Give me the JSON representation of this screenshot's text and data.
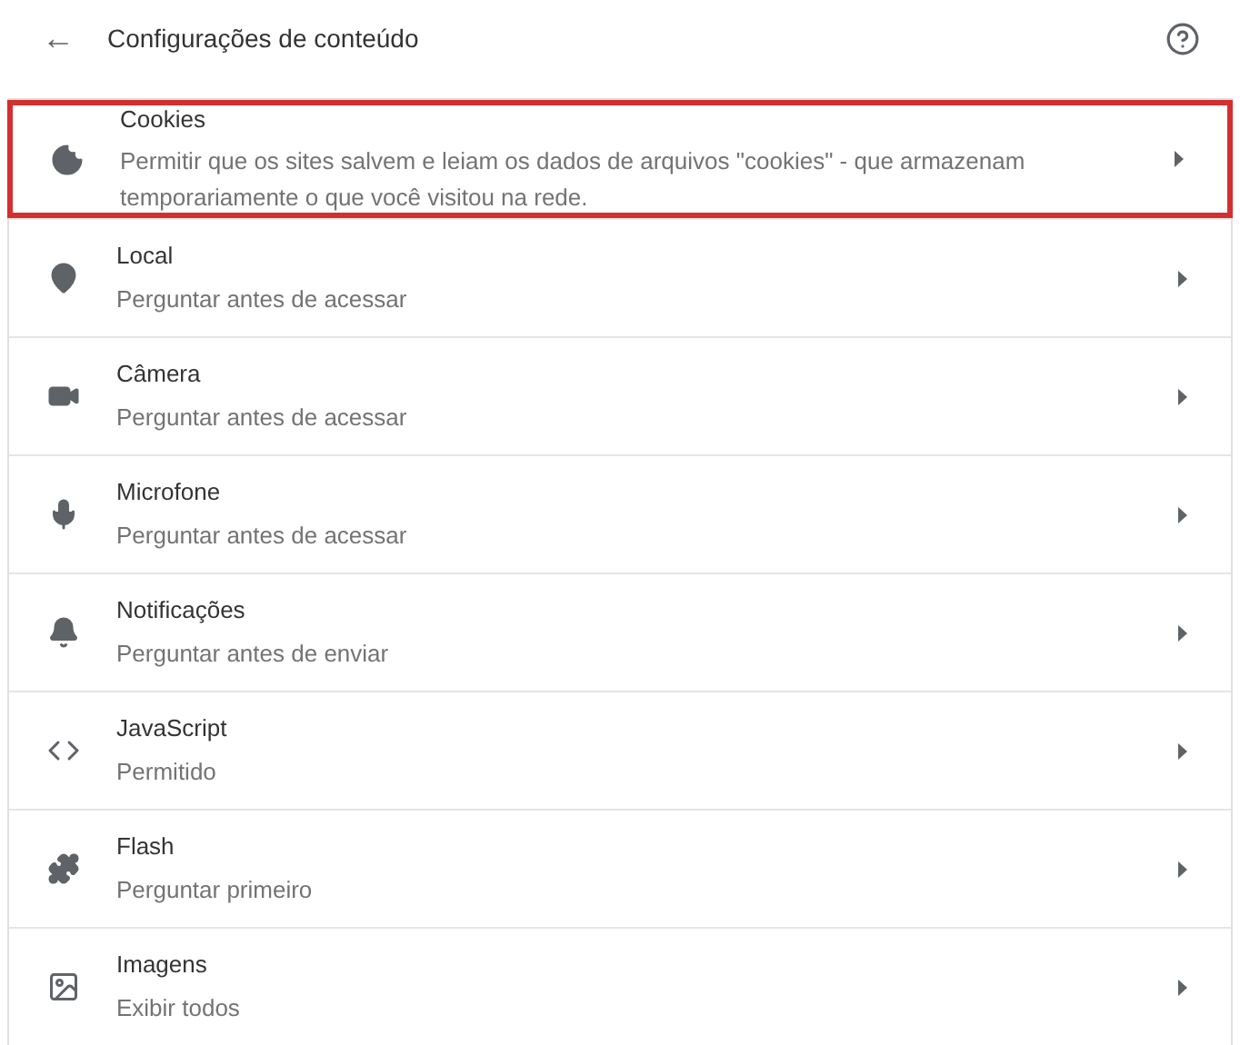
{
  "header": {
    "back": "←",
    "title": "Configurações de conteúdo"
  },
  "items": [
    {
      "kind": "cookie",
      "title": "Cookies",
      "subtitle": "Permitir que os sites salvem e leiam os dados de arquivos \"cookies\" - que armazenam temporariamente o que você visitou na rede.",
      "highlighted": true
    },
    {
      "kind": "location",
      "title": "Local",
      "subtitle": "Perguntar antes de acessar",
      "highlighted": false
    },
    {
      "kind": "camera",
      "title": "Câmera",
      "subtitle": "Perguntar antes de acessar",
      "highlighted": false
    },
    {
      "kind": "mic",
      "title": "Microfone",
      "subtitle": "Perguntar antes de acessar",
      "highlighted": false
    },
    {
      "kind": "bell",
      "title": "Notificações",
      "subtitle": "Perguntar antes de enviar",
      "highlighted": false
    },
    {
      "kind": "code",
      "title": "JavaScript",
      "subtitle": "Permitido",
      "highlighted": false
    },
    {
      "kind": "puzzle",
      "title": "Flash",
      "subtitle": "Perguntar primeiro",
      "highlighted": false
    },
    {
      "kind": "image",
      "title": "Imagens",
      "subtitle": "Exibir todos",
      "highlighted": false
    }
  ]
}
